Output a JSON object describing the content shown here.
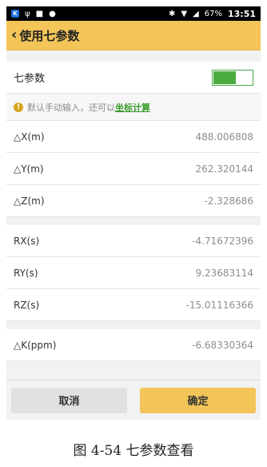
{
  "status_bar": {
    "battery": "67%",
    "time": "13:51"
  },
  "header": {
    "title": "使用七参数"
  },
  "toggle_row": {
    "label": "七参数",
    "enabled": true,
    "color": "#4cab3f"
  },
  "hint": {
    "text": "默认手动输入，还可以",
    "link": "坐标计算"
  },
  "group1": [
    {
      "label": "△X(m)",
      "value": "488.006808"
    },
    {
      "label": "△Y(m)",
      "value": "262.320144"
    },
    {
      "label": "△Z(m)",
      "value": "-2.328686"
    }
  ],
  "group2": [
    {
      "label": "RX(s)",
      "value": "-4.71672396"
    },
    {
      "label": "RY(s)",
      "value": "9.23683114"
    },
    {
      "label": "RZ(s)",
      "value": "-15.01116366"
    }
  ],
  "group3": [
    {
      "label": "△K(ppm)",
      "value": "-6.68330364"
    }
  ],
  "buttons": {
    "cancel": "取消",
    "ok": "确定"
  },
  "caption": "图 4-54 七参数查看",
  "colors": {
    "accent": "#f3c458",
    "link": "#3a9b2c"
  }
}
